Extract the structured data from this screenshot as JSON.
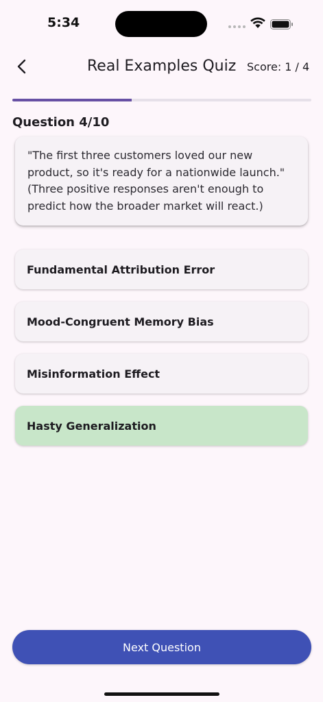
{
  "status_bar": {
    "time": "5:34",
    "icons": [
      "signal-dots-icon",
      "wifi-icon",
      "battery-icon"
    ]
  },
  "app_bar": {
    "back_icon": "chevron-left-icon",
    "title": "Real Examples Quiz",
    "score": "Score: 1 / 4"
  },
  "progress": {
    "fraction": 0.4
  },
  "question": {
    "label": "Question 4/10",
    "text": "\"The first three customers loved our new product, so it's ready for a nationwide launch.\" (Three positive responses aren't enough to predict how the broader market will react.)"
  },
  "options": [
    {
      "label": "Fundamental Attribution Error",
      "state": "default"
    },
    {
      "label": "Mood-Congruent Memory Bias",
      "state": "default"
    },
    {
      "label": "Misinformation Effect",
      "state": "default"
    },
    {
      "label": "Hasty Generalization",
      "state": "correct"
    }
  ],
  "next_button": {
    "label": "Next Question"
  },
  "colors": {
    "background": "#fdf6fb",
    "progress_fill": "#6750a4",
    "progress_track": "#e6e0e9",
    "card": "#f6f2f6",
    "correct_option": "#c8e6c9",
    "primary_button": "#3f51b5"
  }
}
